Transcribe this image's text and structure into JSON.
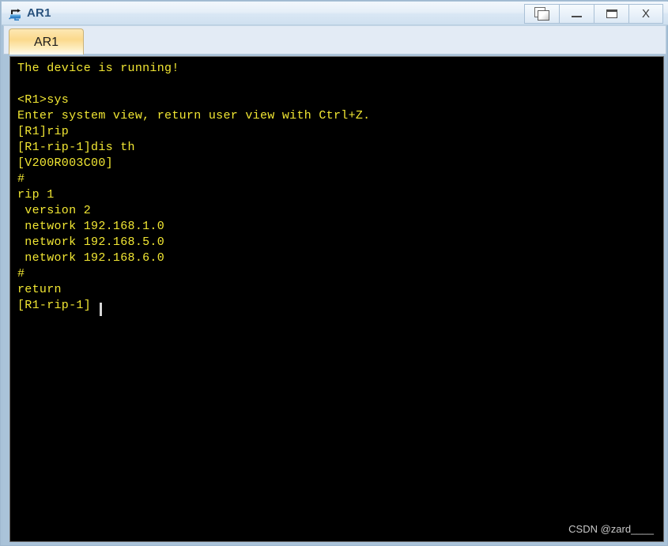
{
  "window": {
    "title": "AR1",
    "icon": "router-icon",
    "controls": [
      {
        "name": "restore-button",
        "icon": "restore-icon",
        "label": ""
      },
      {
        "name": "minimize-button",
        "icon": "minimize-icon",
        "label": ""
      },
      {
        "name": "maximize-button",
        "icon": "maximize-icon",
        "label": ""
      },
      {
        "name": "close-button",
        "icon": "close-icon",
        "label": "X"
      }
    ]
  },
  "tabs": [
    {
      "label": "AR1",
      "active": true
    }
  ],
  "terminal": {
    "foreground_color": "#f2e733",
    "background_color": "#000000",
    "cursor": "block",
    "lines": [
      "The device is running!",
      "",
      "<R1>sys",
      "Enter system view, return user view with Ctrl+Z.",
      "[R1]rip",
      "[R1-rip-1]dis th",
      "[V200R003C00]",
      "#",
      "rip 1",
      " version 2",
      " network 192.168.1.0",
      " network 192.168.5.0",
      " network 192.168.6.0",
      "#",
      "return",
      "[R1-rip-1]"
    ],
    "text": "The device is running!\n\n<R1>sys\nEnter system view, return user view with Ctrl+Z.\n[R1]rip\n[R1-rip-1]dis th\n[V200R003C00]\n#\nrip 1\n version 2\n network 192.168.1.0\n network 192.168.5.0\n network 192.168.6.0\n#\nreturn\n[R1-rip-1]"
  },
  "watermark": {
    "text": "CSDN @zard____"
  }
}
